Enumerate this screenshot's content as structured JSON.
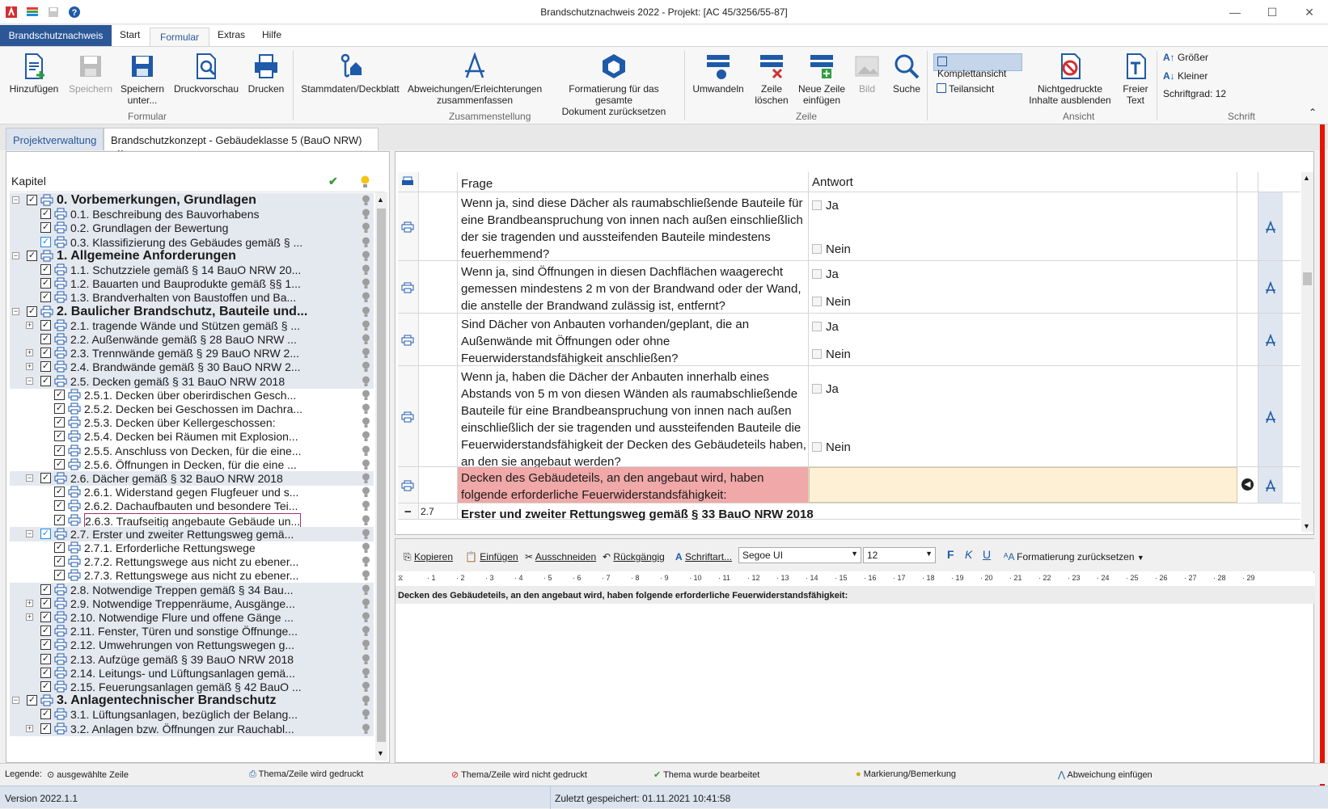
{
  "window": {
    "title": "Brandschutznachweis 2022 - Projekt: [AC 45/3256/55-87]"
  },
  "menu": {
    "app": "Brandschutznachweis",
    "tabs": [
      "Start",
      "Formular",
      "Extras",
      "Hilfe"
    ],
    "active": "Formular"
  },
  "ribbon": {
    "formular": {
      "add": "Hinzufügen",
      "save": "Speichern",
      "saveas1": "Speichern",
      "saveas2": "unter...",
      "preview": "Druckvorschau",
      "print": "Drucken",
      "group": "Formular"
    },
    "zusammen": {
      "stamm": "Stammdaten/Deckblatt",
      "abw1": "Abweichungen/Erleichterungen",
      "abw2": "zusammenfassen",
      "fmt1": "Formatierung für das gesamte",
      "fmt2": "Dokument zurücksetzen",
      "group": "Zusammenstellung"
    },
    "zeile": {
      "convert": "Umwandeln",
      "del1": "Zeile",
      "del2": "löschen",
      "new1": "Neue Zeile",
      "new2": "einfügen",
      "image": "Bild",
      "group": "Zeile"
    },
    "search": "Suche",
    "ansicht": {
      "full": "Komplettansicht",
      "part": "Teilansicht",
      "hide1": "Nichtgedruckte",
      "hide2": "Inhalte ausblenden",
      "free1": "Freier",
      "free2": "Text",
      "group": "Ansicht"
    },
    "schrift": {
      "bigger": "Größer",
      "smaller": "Kleiner",
      "size": "Schriftgrad: 12",
      "group": "Schrift"
    }
  },
  "doctabs": {
    "t1": "Projektverwaltung",
    "t2": "Brandschutzkonzept - Gebäudeklasse 5 (BauO NRW)",
    "close": "×"
  },
  "tree": {
    "header": "Kapitel",
    "items": [
      {
        "t": "0. Vorbemerkungen, Grundlagen",
        "l": 0,
        "b": true,
        "e": "-"
      },
      {
        "t": "0.1. Beschreibung des Bauvorhabens",
        "l": 1
      },
      {
        "t": "0.2. Grundlagen der Bewertung",
        "l": 1
      },
      {
        "t": "0.3. Klassifizierung des Gebäudes gemäß § ...",
        "l": 1,
        "blue": true
      },
      {
        "t": "1. Allgemeine Anforderungen",
        "l": 0,
        "b": true,
        "e": "-"
      },
      {
        "t": "1.1. Schutzziele gemäß § 14 BauO NRW 20...",
        "l": 1
      },
      {
        "t": "1.2. Bauarten und Bauprodukte gemäß §§ 1...",
        "l": 1
      },
      {
        "t": "1.3. Brandverhalten von Baustoffen und Ba...",
        "l": 1
      },
      {
        "t": "2. Baulicher Brandschutz, Bauteile und...",
        "l": 0,
        "b": true,
        "e": "-"
      },
      {
        "t": "2.1. tragende Wände und Stützen gemäß § ...",
        "l": 1,
        "e": "+"
      },
      {
        "t": "2.2. Außenwände gemäß § 28 BauO NRW ...",
        "l": 1
      },
      {
        "t": "2.3. Trennwände gemäß § 29 BauO NRW 2...",
        "l": 1,
        "e": "+"
      },
      {
        "t": "2.4. Brandwände gemäß § 30 BauO NRW 2...",
        "l": 1,
        "e": "+"
      },
      {
        "t": "2.5. Decken gemäß § 31 BauO NRW 2018",
        "l": 1,
        "e": "-"
      },
      {
        "t": "2.5.1. Decken über oberirdischen Gesch...",
        "l": 2
      },
      {
        "t": "2.5.2. Decken bei Geschossen im Dachra...",
        "l": 2
      },
      {
        "t": "2.5.3. Decken über Kellergeschossen:",
        "l": 2
      },
      {
        "t": "2.5.4. Decken bei Räumen mit Explosion...",
        "l": 2
      },
      {
        "t": "2.5.5. Anschluss von Decken, für die eine...",
        "l": 2
      },
      {
        "t": "2.5.6. Öffnungen in Decken, für die eine ...",
        "l": 2
      },
      {
        "t": "2.6. Dächer gemäß § 32 BauO NRW 2018",
        "l": 1,
        "e": "-"
      },
      {
        "t": "2.6.1. Widerstand gegen Flugfeuer und s...",
        "l": 2
      },
      {
        "t": "2.6.2. Dachaufbauten und besondere Tei...",
        "l": 2
      },
      {
        "t": "2.6.3. Traufseitig angebaute Gebäude un...",
        "l": 2,
        "sel": true
      },
      {
        "t": "2.7. Erster und zweiter Rettungsweg gemä...",
        "l": 1,
        "e": "-",
        "blue": true
      },
      {
        "t": "2.7.1. Erforderliche Rettungswege",
        "l": 2
      },
      {
        "t": "2.7.2. Rettungswege aus nicht zu ebener...",
        "l": 2
      },
      {
        "t": "2.7.3. Rettungswege aus nicht zu ebener...",
        "l": 2
      },
      {
        "t": "2.8. Notwendige Treppen gemäß § 34 Bau...",
        "l": 1
      },
      {
        "t": "2.9. Notwendige Treppenräume, Ausgänge...",
        "l": 1,
        "e": "+"
      },
      {
        "t": "2.10. Notwendige Flure und offene Gänge ...",
        "l": 1,
        "e": "+"
      },
      {
        "t": "2.11. Fenster, Türen und sonstige Öffnunge...",
        "l": 1
      },
      {
        "t": "2.12. Umwehrungen von Rettungswegen g...",
        "l": 1
      },
      {
        "t": "2.13. Aufzüge gemäß § 39 BauO NRW 2018",
        "l": 1
      },
      {
        "t": "2.14. Leitungs- und Lüftungsanlagen gemä...",
        "l": 1
      },
      {
        "t": "2.15. Feuerungsanlagen gemäß § 42 BauO ...",
        "l": 1
      },
      {
        "t": "3. Anlagentechnischer Brandschutz",
        "l": 0,
        "b": true,
        "e": "-"
      },
      {
        "t": "3.1. Lüftungsanlagen, bezüglich der Belang...",
        "l": 1
      },
      {
        "t": "3.2. Anlagen bzw. Öffnungen zur Rauchabl...",
        "l": 1,
        "e": "+"
      }
    ]
  },
  "grid": {
    "col_frage": "Frage",
    "col_antwort": "Antwort",
    "rows": [
      {
        "q": "Wenn ja, sind diese Dächer als raumabschließende Bauteile für eine Brandbeanspruchung von innen nach außen einschließlich der sie tragenden und aussteifenden Bauteile mindestens feuerhemmend?",
        "ja": "Ja",
        "nein": "Nein"
      },
      {
        "q": "Wenn ja, sind Öffnungen in diesen Dachflächen waagerecht gemessen mindestens 2 m von der Brandwand oder der Wand, die anstelle der Brandwand zulässig ist, entfernt?",
        "ja": "Ja",
        "nein": "Nein"
      },
      {
        "q": "Sind Dächer von Anbauten vorhanden/geplant, die an Außenwände mit Öffnungen oder ohne Feuerwiderstandsfähigkeit anschließen?",
        "ja": "Ja",
        "nein": "Nein"
      },
      {
        "q": "Wenn ja, haben die Dächer der Anbauten innerhalb eines Abstands von 5 m von diesen Wänden als raumabschließende Bauteile für eine Brandbeanspruchung von innen nach außen einschließlich der sie tragenden und aussteifenden Bauteile die Feuerwiderstandsfähigkeit der Decken des Gebäudeteils haben, an den sie angebaut werden?",
        "ja": "Ja",
        "nein": "Nein"
      },
      {
        "q": "Decken des Gebäudeteils, an den angebaut wird, haben folgende erforderliche Feuerwiderstandsfähigkeit:"
      }
    ],
    "next_num": "2.7",
    "next_text": "Erster und zweiter Rettungsweg gemäß § 33 BauO NRW 2018"
  },
  "editor": {
    "copy": "Kopieren",
    "paste": "Einfügen",
    "cut": "Ausschneiden",
    "undo": "Rückgängig",
    "font_label": "Schriftart...",
    "font": "Segoe UI",
    "size": "12",
    "bold": "F",
    "italic": "K",
    "underline": "U",
    "reset": "Formatierung zurücksetzen",
    "text": "Decken des Gebäudeteils, an den angebaut wird, haben folgende erforderliche Feuerwiderstandsfähigkeit:"
  },
  "legend": {
    "label": "Legende:",
    "l1": "ausgewählte Zeile",
    "l2": "Thema/Zeile wird gedruckt",
    "l3": "Thema/Zeile wird nicht gedruckt",
    "l4": "Thema wurde bearbeitet",
    "l5": "Markierung/Bemerkung",
    "l6": "Abweichung einfügen"
  },
  "status": {
    "version": "Version 2022.1.1",
    "saved": "Zuletzt gespeichert: 01.11.2021 10:41:58"
  },
  "colors": {
    "accent": "#2b5797",
    "selected_row": "#f0a8a8",
    "answer_cell": "#fdf0d5",
    "red_bar": "#e51400"
  }
}
